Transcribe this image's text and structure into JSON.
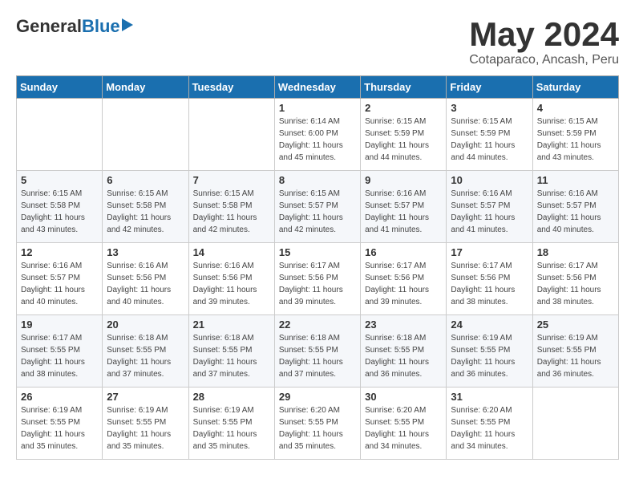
{
  "header": {
    "logo_general": "General",
    "logo_blue": "Blue",
    "month": "May 2024",
    "location": "Cotaparaco, Ancash, Peru"
  },
  "days_of_week": [
    "Sunday",
    "Monday",
    "Tuesday",
    "Wednesday",
    "Thursday",
    "Friday",
    "Saturday"
  ],
  "weeks": [
    [
      {
        "day": "",
        "info": ""
      },
      {
        "day": "",
        "info": ""
      },
      {
        "day": "",
        "info": ""
      },
      {
        "day": "1",
        "sunrise": "6:14 AM",
        "sunset": "6:00 PM",
        "daylight": "11 hours and 45 minutes."
      },
      {
        "day": "2",
        "sunrise": "6:15 AM",
        "sunset": "5:59 PM",
        "daylight": "11 hours and 44 minutes."
      },
      {
        "day": "3",
        "sunrise": "6:15 AM",
        "sunset": "5:59 PM",
        "daylight": "11 hours and 44 minutes."
      },
      {
        "day": "4",
        "sunrise": "6:15 AM",
        "sunset": "5:59 PM",
        "daylight": "11 hours and 43 minutes."
      }
    ],
    [
      {
        "day": "5",
        "sunrise": "6:15 AM",
        "sunset": "5:58 PM",
        "daylight": "11 hours and 43 minutes."
      },
      {
        "day": "6",
        "sunrise": "6:15 AM",
        "sunset": "5:58 PM",
        "daylight": "11 hours and 42 minutes."
      },
      {
        "day": "7",
        "sunrise": "6:15 AM",
        "sunset": "5:58 PM",
        "daylight": "11 hours and 42 minutes."
      },
      {
        "day": "8",
        "sunrise": "6:15 AM",
        "sunset": "5:57 PM",
        "daylight": "11 hours and 42 minutes."
      },
      {
        "day": "9",
        "sunrise": "6:16 AM",
        "sunset": "5:57 PM",
        "daylight": "11 hours and 41 minutes."
      },
      {
        "day": "10",
        "sunrise": "6:16 AM",
        "sunset": "5:57 PM",
        "daylight": "11 hours and 41 minutes."
      },
      {
        "day": "11",
        "sunrise": "6:16 AM",
        "sunset": "5:57 PM",
        "daylight": "11 hours and 40 minutes."
      }
    ],
    [
      {
        "day": "12",
        "sunrise": "6:16 AM",
        "sunset": "5:57 PM",
        "daylight": "11 hours and 40 minutes."
      },
      {
        "day": "13",
        "sunrise": "6:16 AM",
        "sunset": "5:56 PM",
        "daylight": "11 hours and 40 minutes."
      },
      {
        "day": "14",
        "sunrise": "6:16 AM",
        "sunset": "5:56 PM",
        "daylight": "11 hours and 39 minutes."
      },
      {
        "day": "15",
        "sunrise": "6:17 AM",
        "sunset": "5:56 PM",
        "daylight": "11 hours and 39 minutes."
      },
      {
        "day": "16",
        "sunrise": "6:17 AM",
        "sunset": "5:56 PM",
        "daylight": "11 hours and 39 minutes."
      },
      {
        "day": "17",
        "sunrise": "6:17 AM",
        "sunset": "5:56 PM",
        "daylight": "11 hours and 38 minutes."
      },
      {
        "day": "18",
        "sunrise": "6:17 AM",
        "sunset": "5:56 PM",
        "daylight": "11 hours and 38 minutes."
      }
    ],
    [
      {
        "day": "19",
        "sunrise": "6:17 AM",
        "sunset": "5:55 PM",
        "daylight": "11 hours and 38 minutes."
      },
      {
        "day": "20",
        "sunrise": "6:18 AM",
        "sunset": "5:55 PM",
        "daylight": "11 hours and 37 minutes."
      },
      {
        "day": "21",
        "sunrise": "6:18 AM",
        "sunset": "5:55 PM",
        "daylight": "11 hours and 37 minutes."
      },
      {
        "day": "22",
        "sunrise": "6:18 AM",
        "sunset": "5:55 PM",
        "daylight": "11 hours and 37 minutes."
      },
      {
        "day": "23",
        "sunrise": "6:18 AM",
        "sunset": "5:55 PM",
        "daylight": "11 hours and 36 minutes."
      },
      {
        "day": "24",
        "sunrise": "6:19 AM",
        "sunset": "5:55 PM",
        "daylight": "11 hours and 36 minutes."
      },
      {
        "day": "25",
        "sunrise": "6:19 AM",
        "sunset": "5:55 PM",
        "daylight": "11 hours and 36 minutes."
      }
    ],
    [
      {
        "day": "26",
        "sunrise": "6:19 AM",
        "sunset": "5:55 PM",
        "daylight": "11 hours and 35 minutes."
      },
      {
        "day": "27",
        "sunrise": "6:19 AM",
        "sunset": "5:55 PM",
        "daylight": "11 hours and 35 minutes."
      },
      {
        "day": "28",
        "sunrise": "6:19 AM",
        "sunset": "5:55 PM",
        "daylight": "11 hours and 35 minutes."
      },
      {
        "day": "29",
        "sunrise": "6:20 AM",
        "sunset": "5:55 PM",
        "daylight": "11 hours and 35 minutes."
      },
      {
        "day": "30",
        "sunrise": "6:20 AM",
        "sunset": "5:55 PM",
        "daylight": "11 hours and 34 minutes."
      },
      {
        "day": "31",
        "sunrise": "6:20 AM",
        "sunset": "5:55 PM",
        "daylight": "11 hours and 34 minutes."
      },
      {
        "day": "",
        "info": ""
      }
    ]
  ]
}
